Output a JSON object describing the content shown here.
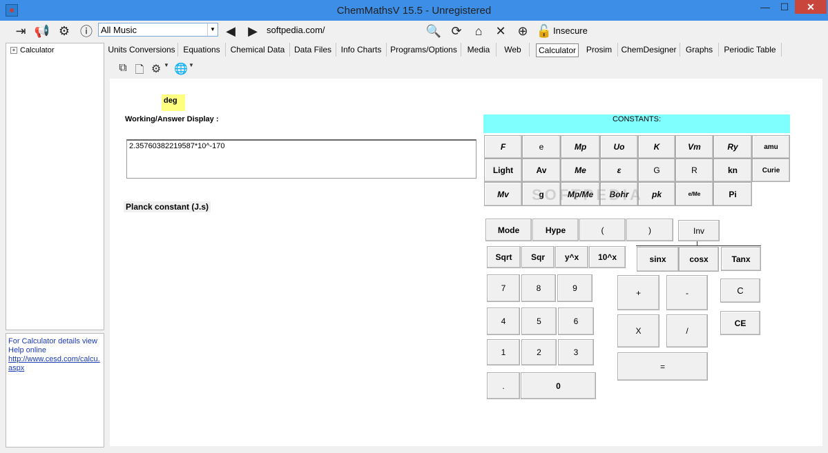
{
  "window": {
    "title": "ChemMathsV 15.5 - Unregistered",
    "min": "—",
    "max": "☐",
    "close": "✕"
  },
  "toolbar": {
    "combo_value": "All Music",
    "url": "softpedia.com/",
    "insecure_label": "Insecure",
    "icons": [
      "exit-icon",
      "megaphone-icon",
      "gears-icon",
      "info-icon",
      "back-icon",
      "forward-icon",
      "search-icon",
      "refresh-icon",
      "home-icon",
      "stop-icon",
      "new-tab-icon",
      "unlock-icon"
    ]
  },
  "tree": {
    "item": "Calculator",
    "expander": "+"
  },
  "help": {
    "text": "For Calculator details view Help online",
    "link": "http://www.cesd.com/calcu.aspx"
  },
  "tabs": [
    "Units Conversions",
    "Equations",
    "Chemical Data",
    "Data Files",
    "Info Charts",
    "Programs/Options",
    "Media",
    "Web",
    "Calculator",
    "Prosim",
    "ChemDesigner",
    "Graphs",
    "Periodic Table"
  ],
  "active_tab": "Calculator",
  "calc": {
    "mode_badge": "deg",
    "work_label": "Working/Answer Display :",
    "display_value": "2.35760382219587*10^-170",
    "constant_caption": "Planck constant (J.s)",
    "constants_header": "CONSTANTS:",
    "const_row1": [
      "F",
      "e",
      "Mp",
      "Uo",
      "K",
      "Vm",
      "Ry",
      "amu"
    ],
    "const_row2": [
      "Light",
      "Av",
      "Me",
      "ε",
      "G",
      "R",
      "kn",
      "Curie"
    ],
    "const_row3": [
      "Mv",
      "g",
      "Mp/Me",
      "Bohr",
      "pk",
      "e/Me",
      "Pi"
    ],
    "func_row1": [
      "Mode",
      "Hype",
      "(",
      ")",
      "Inv"
    ],
    "func_row2": [
      "Sqrt",
      "Sqr",
      "y^x",
      "10^x"
    ],
    "trig": [
      "sinx",
      "cosx",
      "Tanx"
    ],
    "digits": [
      "7",
      "8",
      "9",
      "4",
      "5",
      "6",
      "1",
      "2",
      "3",
      ".",
      "0"
    ],
    "ops": [
      "+",
      "-",
      "X",
      "/",
      "="
    ],
    "clear": [
      "C",
      "CE"
    ],
    "watermark": "SOFTPEDIA"
  }
}
